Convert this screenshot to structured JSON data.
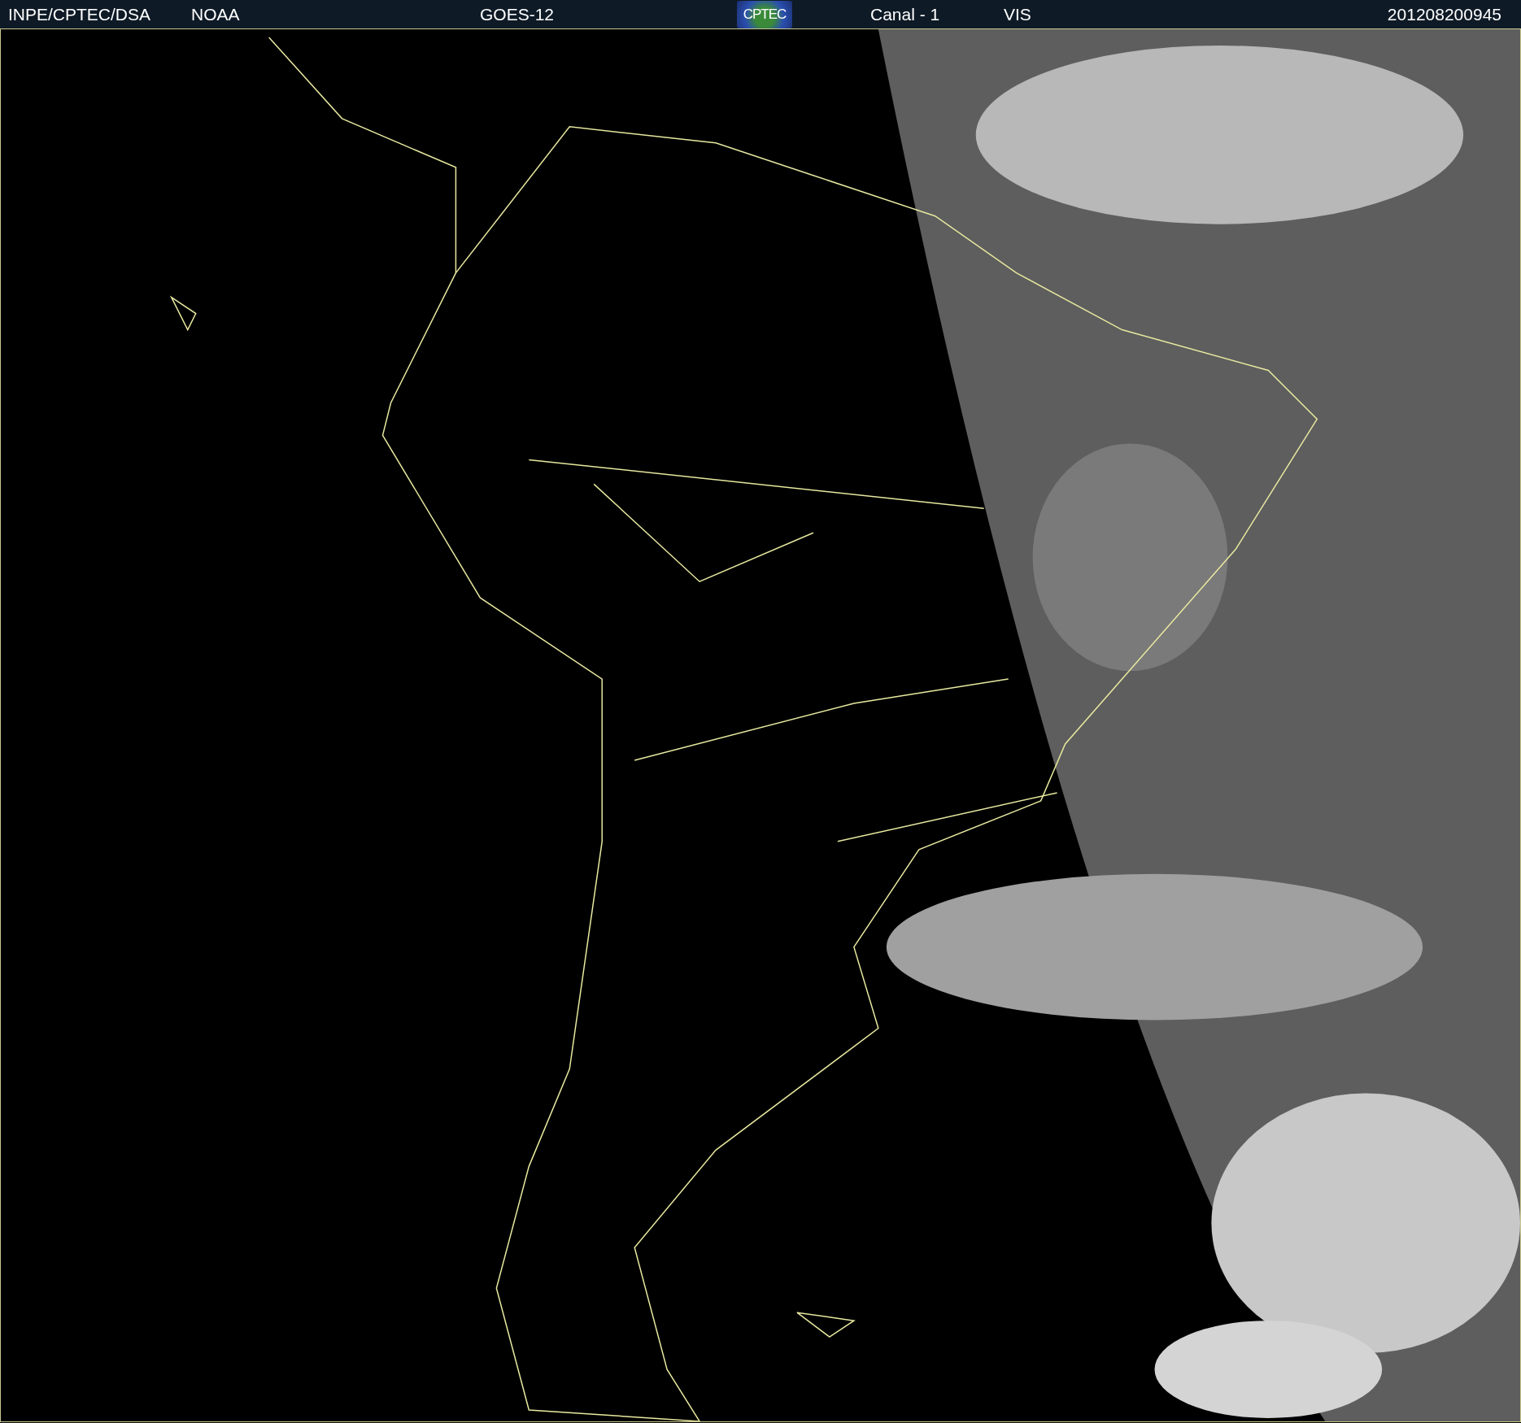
{
  "header": {
    "source": "INPE/CPTEC/DSA",
    "agency": "NOAA",
    "satellite": "GOES-12",
    "logo": "CPTEC",
    "channel": "Canal - 1",
    "band": "VIS",
    "timestamp": "201208200945"
  }
}
